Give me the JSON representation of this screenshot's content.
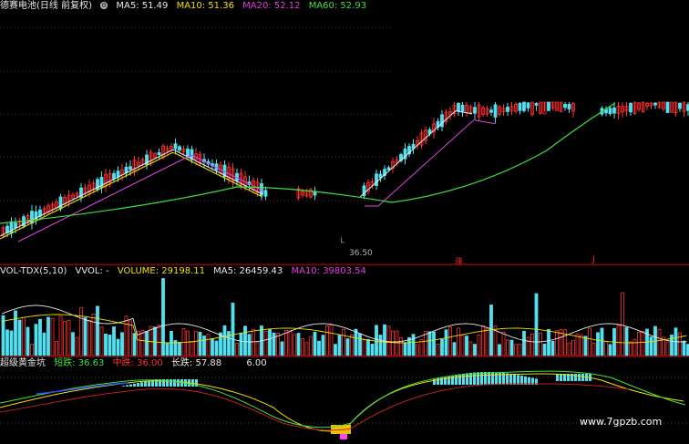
{
  "price_header": {
    "title": "德赛电池(日线 前复权)",
    "ma5": "MA5: 51.49",
    "ma10": "MA10: 51.36",
    "ma20": "MA20: 52.12",
    "ma60": "MA60: 52.93"
  },
  "price_low_label": "36.50",
  "price_marks": [
    "涨",
    "J"
  ],
  "vol_header": {
    "name": "VOL-TDX(5,10)",
    "vvol": "VVOL: -",
    "volume": "VOLUME: 29198.11",
    "ma5": "MA5: 26459.43",
    "ma10": "MA10: 39803.54"
  },
  "osc_header": {
    "name": "超级黄金坑",
    "short": "短跌: 36.63",
    "mid": "中跌: 36.00",
    "long": "长跌: 57.88",
    "extra": "6.00"
  },
  "watermark": "www.7gpzb.com",
  "colors": {
    "up": "#ff3030",
    "down": "#50e0f0",
    "ma5": "#e8e8e8",
    "ma10": "#f0e000",
    "ma20": "#e040e0",
    "ma60": "#40e040"
  }
}
